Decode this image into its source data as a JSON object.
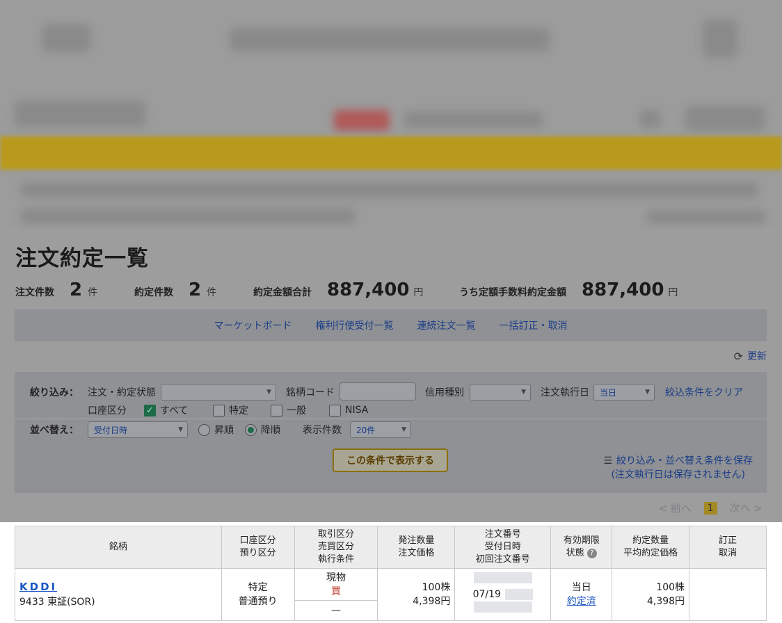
{
  "page_title": "注文約定一覧",
  "summary": {
    "order_count_label": "注文件数",
    "order_count": "2",
    "unit_ken": "件",
    "exec_count_label": "約定件数",
    "exec_count": "2",
    "total_label": "約定金額合計",
    "total": "887,400",
    "unit_yen": "円",
    "fixed_fee_label": "うち定額手数料約定金額",
    "fixed_fee_total": "887,400"
  },
  "nav": {
    "market_board": "マーケットボード",
    "rights_list": "権利行使受付一覧",
    "continuous_list": "連続注文一覧",
    "bulk_edit": "一括訂正・取消"
  },
  "refresh_label": "更新",
  "filter": {
    "narrow_label": "絞り込み：",
    "status_label": "注文・約定状態",
    "status_value": "",
    "code_label": "銘柄コード",
    "code_value": "",
    "credit_label": "信用種別",
    "credit_value": "",
    "exec_date_label": "注文執行日",
    "exec_date_value": "当日",
    "clear_label": "絞込条件をクリア",
    "account_label": "口座区分",
    "account_all": "すべて",
    "account_tokutei": "特定",
    "account_ippan": "一般",
    "account_nisa": "NISA",
    "sort_label": "並べ替え：",
    "sort_value": "受付日時",
    "asc_label": "昇順",
    "desc_label": "降順",
    "count_label": "表示件数",
    "count_value": "20件",
    "show_button": "この条件で表示する",
    "save_line1": "絞り込み・並べ替え条件を保存",
    "save_line2": "(注文執行日は保存されません)"
  },
  "pager": {
    "prev": "< 前へ",
    "current": "1",
    "next": "次へ >"
  },
  "table": {
    "headers": {
      "brand": "銘柄",
      "account_1": "口座区分",
      "account_2": "預り区分",
      "trade_1": "取引区分",
      "trade_2": "売買区分",
      "trade_3": "執行条件",
      "qty_1": "発注数量",
      "qty_2": "注文価格",
      "order_1": "注文番号",
      "order_2": "受付日時",
      "order_3": "初回注文番号",
      "expiry_1": "有効期限",
      "expiry_2": "状態",
      "exec_1": "約定数量",
      "exec_2": "平均約定価格",
      "edit_1": "訂正",
      "edit_2": "取消"
    },
    "rows": [
      {
        "name": "KDDI",
        "code": "9433 東証(SOR)",
        "account": "特定",
        "deposit": "普通預り",
        "trade": "現物",
        "side": "買",
        "condition": "—",
        "qty": "100株",
        "price": "4,398円",
        "received": "07/19",
        "expiry": "当日",
        "status": "約定済",
        "exec_qty": "100株",
        "exec_price": "4,398円"
      }
    ]
  }
}
